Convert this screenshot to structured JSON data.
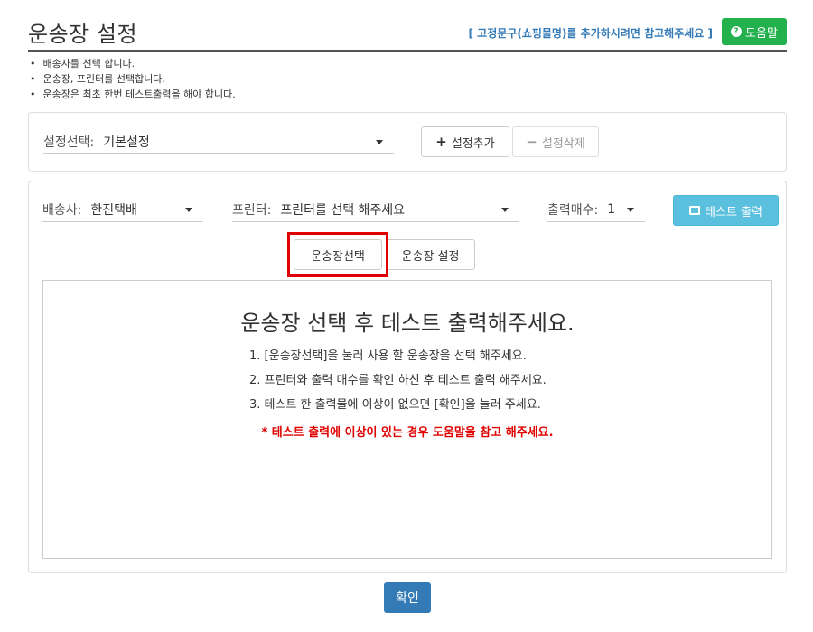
{
  "header": {
    "title": "운송장 설정",
    "hint_link": "[ 고정문구(쇼핑몰명)를 추가하시려면 참고해주세요 ]",
    "help_label": "도움말",
    "help_icon": "question-circle-icon"
  },
  "notes": [
    "배송사를 선택 합니다.",
    "운송장, 프린터를 선택합니다.",
    "운송장은 최초 한번 테스트출력을 해야 합니다."
  ],
  "settings": {
    "label": "설정선택:",
    "value": "기본설정",
    "add_label": "설정추가",
    "delete_label": "설정삭제"
  },
  "options": {
    "carrier_label": "배송사:",
    "carrier_value": "한진택배",
    "printer_label": "프린터:",
    "printer_value": "프린터를 선택 해주세요",
    "copies_label": "출력매수:",
    "copies_value": "1",
    "test_print_label": "테스트 출력"
  },
  "tabs": {
    "select_label": "운송장선택",
    "setup_label": "운송장 설정"
  },
  "preview": {
    "title": "운송장 선택 후 테스트 출력해주세요.",
    "steps": [
      "1. [운송장선택]을 눌러 사용 할 운송장을 선택 해주세요.",
      "2. 프린터와 출력 매수를 확인 하신 후 테스트 출력 해주세요.",
      "3. 테스트 한 출력물에 이상이 없으면 [확인]을 눌러 주세요."
    ],
    "warning": "* 테스트 출력에 이상이 있는 경우 도움말을 참고 해주세요."
  },
  "footer": {
    "confirm_label": "확인"
  },
  "colors": {
    "help_green": "#22b14c",
    "link_blue": "#337ab7",
    "test_button": "#5bc0de",
    "highlight_red": "#e00000",
    "warning_red": "#e00000"
  }
}
